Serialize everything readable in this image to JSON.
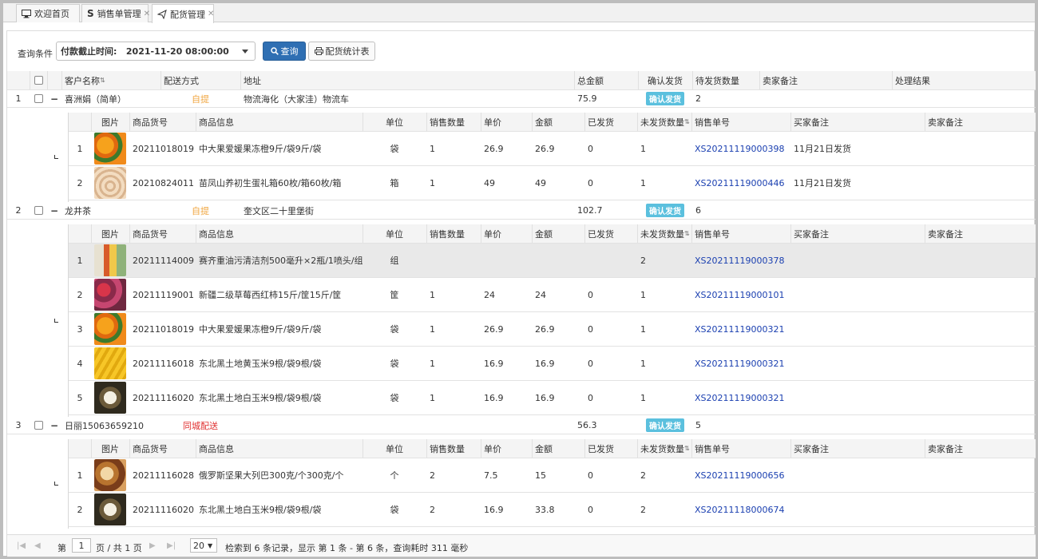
{
  "tabs": [
    {
      "label": "欢迎首页",
      "icon": "monitor-icon"
    },
    {
      "label": "销售单管理",
      "icon": "s-icon"
    },
    {
      "label": "配货管理",
      "icon": "send-icon"
    }
  ],
  "toolbar": {
    "query_label": "查询条件",
    "select_value": "付款截止时间:   2021-11-20 08:00:00",
    "query_button": "查询",
    "stats_button": "配货统计表"
  },
  "headers": {
    "customer": "客户名称",
    "delivery": "配送方式",
    "address": "地址",
    "total": "总金额",
    "confirm": "确认发货",
    "pending_qty": "待发货数量",
    "seller_note": "卖家备注",
    "result": "处理结果"
  },
  "detail_headers": {
    "image": "图片",
    "sku": "商品货号",
    "info": "商品信息",
    "unit": "单位",
    "sales_qty": "销售数量",
    "price": "单价",
    "amount": "金额",
    "shipped": "已发货",
    "unshipped": "未发货数量",
    "order_no": "销售单号",
    "buyer_note": "买家备注",
    "seller_note": "卖家备注"
  },
  "groups": [
    {
      "index": "1",
      "expand": "−",
      "customer": "喜洲娟（简单）",
      "delivery": "自提",
      "delivery_color": "#f0a640",
      "address": "物流海化（大家洼）物流车",
      "total": "75.9",
      "confirm_label": "确认发货",
      "pending": "2",
      "items": [
        {
          "no": "1",
          "sku": "20211018019",
          "info": "中大果爱媛果冻橙9斤/袋9斤/袋",
          "unit": "袋",
          "qty": "1",
          "price": "26.9",
          "amount": "26.9",
          "shipped": "0",
          "unshipped": "1",
          "order": "XS20211119000398",
          "buyer_note": "11月21日发货",
          "thumb": "orange"
        },
        {
          "no": "2",
          "sku": "20210824011",
          "info": "苗凤山养初生蛋礼箱60枚/箱60枚/箱",
          "unit": "箱",
          "qty": "1",
          "price": "49",
          "amount": "49",
          "shipped": "0",
          "unshipped": "1",
          "order": "XS20211119000446",
          "buyer_note": "11月21日发货",
          "thumb": "eggs"
        }
      ]
    },
    {
      "index": "2",
      "expand": "−",
      "customer": "龙井茶",
      "delivery": "自提",
      "delivery_color": "#f0a640",
      "address": "奎文区二十里堡街",
      "total": "102.7",
      "confirm_label": "确认发货",
      "pending": "6",
      "items": [
        {
          "no": "1",
          "sku": "20211114009",
          "info": "赛齐重油污清洁剂500毫升×2瓶/1喷头/组...",
          "unit": "组",
          "qty": "",
          "price": "",
          "amount": "",
          "shipped": "",
          "unshipped": "2",
          "order": "XS20211119000378",
          "buyer_note": "",
          "thumb": "bottles",
          "highlight": true
        },
        {
          "no": "2",
          "sku": "20211119001",
          "info": "新疆二级草莓西红柿15斤/筐15斤/筐",
          "unit": "筐",
          "qty": "1",
          "price": "24",
          "amount": "24",
          "shipped": "0",
          "unshipped": "1",
          "order": "XS20211119000101",
          "buyer_note": "",
          "thumb": "tomato"
        },
        {
          "no": "3",
          "sku": "20211018019",
          "info": "中大果爱媛果冻橙9斤/袋9斤/袋",
          "unit": "袋",
          "qty": "1",
          "price": "26.9",
          "amount": "26.9",
          "shipped": "0",
          "unshipped": "1",
          "order": "XS20211119000321",
          "buyer_note": "",
          "thumb": "orange"
        },
        {
          "no": "4",
          "sku": "20211116018",
          "info": "东北黑土地黄玉米9根/袋9根/袋",
          "unit": "袋",
          "qty": "1",
          "price": "16.9",
          "amount": "16.9",
          "shipped": "0",
          "unshipped": "1",
          "order": "XS20211119000321",
          "buyer_note": "",
          "thumb": "corn"
        },
        {
          "no": "5",
          "sku": "20211116020",
          "info": "东北黑土地白玉米9根/袋9根/袋",
          "unit": "袋",
          "qty": "1",
          "price": "16.9",
          "amount": "16.9",
          "shipped": "0",
          "unshipped": "1",
          "order": "XS20211119000321",
          "buyer_note": "",
          "thumb": "whitecorn"
        }
      ]
    },
    {
      "index": "3",
      "expand": "−",
      "customer": "日丽15063659210",
      "delivery": "同城配送",
      "delivery_color": "#e03131",
      "address": "",
      "total": "56.3",
      "confirm_label": "确认发货",
      "pending": "5",
      "items": [
        {
          "no": "1",
          "sku": "20211116028",
          "info": "俄罗斯坚果大列巴300克/个300克/个",
          "unit": "个",
          "qty": "2",
          "price": "7.5",
          "amount": "15",
          "shipped": "0",
          "unshipped": "2",
          "order": "XS20211119000656",
          "buyer_note": "",
          "thumb": "bread"
        },
        {
          "no": "2",
          "sku": "20211116020",
          "info": "东北黑土地白玉米9根/袋9根/袋",
          "unit": "袋",
          "qty": "2",
          "price": "16.9",
          "amount": "33.8",
          "shipped": "0",
          "unshipped": "2",
          "order": "XS20211118000674",
          "buyer_note": "",
          "thumb": "whitecorn"
        }
      ]
    }
  ],
  "pager": {
    "page_prefix": "第",
    "page_value": "1",
    "page_suffix": "页 / 共 1 页",
    "page_size": "20",
    "summary": "检索到 6 条记录，显示 第 1 条 - 第 6 条，查询耗时 311 毫秒"
  }
}
